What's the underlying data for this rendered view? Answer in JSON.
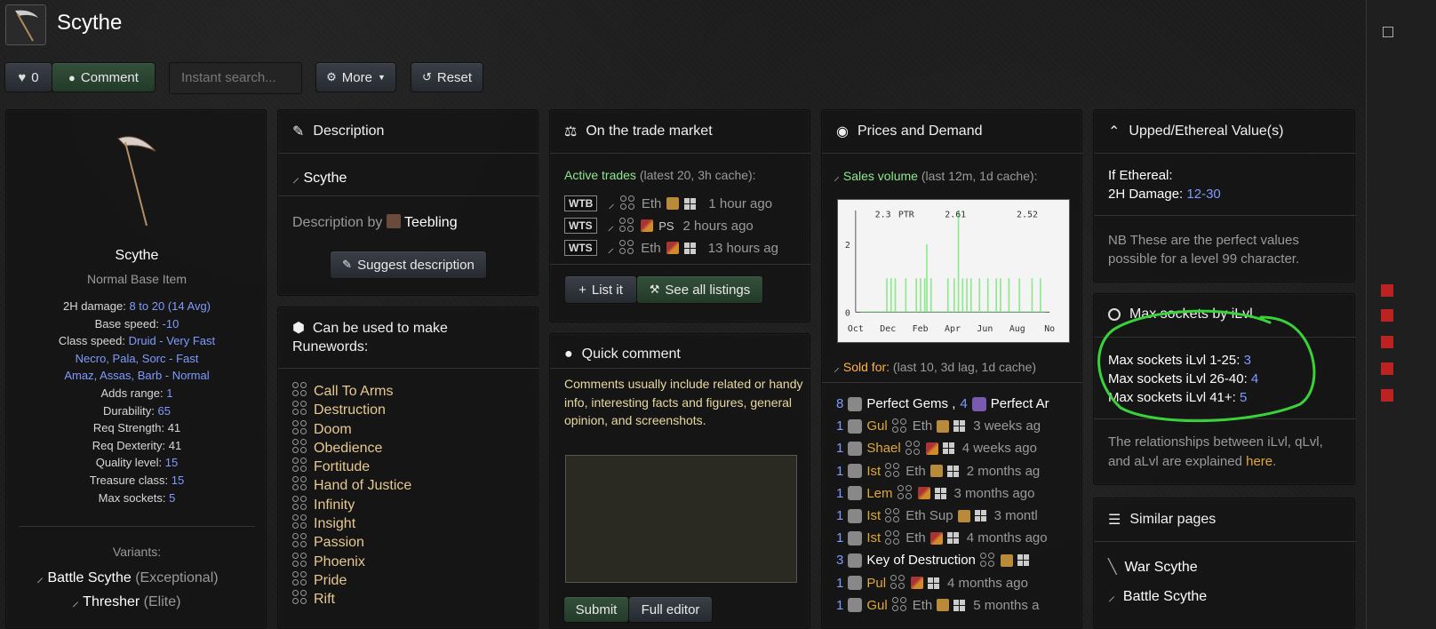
{
  "header": {
    "title": "Scythe"
  },
  "toolbar": {
    "like_count": "0",
    "comment_label": "Comment",
    "search_placeholder": "Instant search...",
    "more_label": "More",
    "reset_label": "Reset"
  },
  "item": {
    "name": "Scythe",
    "subtitle": "Normal Base Item",
    "stats": [
      {
        "label": "2H damage:",
        "value": "8 to 20 (14 Avg)"
      },
      {
        "label": "Base speed:",
        "value": "-10"
      },
      {
        "label": "Class speed:",
        "value": "Druid - Very Fast"
      }
    ],
    "class_speed_more": [
      "Necro, Pala, Sorc - Fast",
      "Amaz, Assas, Barb - Normal"
    ],
    "stats2": [
      {
        "label": "Adds range:",
        "value": "1"
      },
      {
        "label": "Durability:",
        "value": "65"
      },
      {
        "label": "Req Strength:",
        "value": "41"
      },
      {
        "label": "Req Dexterity:",
        "value": "41"
      },
      {
        "label": "Quality level:",
        "value": "15"
      },
      {
        "label": "Treasure class:",
        "value": "15"
      },
      {
        "label": "Max sockets:",
        "value": "5"
      }
    ],
    "variants_heading": "Variants:",
    "variants": [
      {
        "name": "Battle Scythe",
        "tier": "(Exceptional)"
      },
      {
        "name": "Thresher",
        "tier": "(Elite)"
      }
    ]
  },
  "description": {
    "heading": "Description",
    "item_name": "Scythe",
    "by_label": "Description by",
    "author": "Teebling",
    "suggest_label": "Suggest description"
  },
  "runewords": {
    "heading_line1": "Can be used to make",
    "heading_line2": "Runewords:",
    "items": [
      "Call To Arms",
      "Destruction",
      "Doom",
      "Obedience",
      "Fortitude",
      "Hand of Justice",
      "Infinity",
      "Insight",
      "Passion",
      "Phoenix",
      "Pride",
      "Rift"
    ]
  },
  "trade": {
    "heading": "On the trade market",
    "active_label": "Active trades",
    "active_note": "(latest 20, 3h cache):",
    "rows": [
      {
        "tag": "WTB",
        "eth": "Eth",
        "time": "1 hour ago"
      },
      {
        "tag": "WTS",
        "eth": "",
        "time": "2 hours ago"
      },
      {
        "tag": "WTS",
        "eth": "Eth",
        "time": "13 hours ag"
      }
    ],
    "list_label": "List it",
    "see_all_label": "See all listings"
  },
  "quick_comment": {
    "heading": "Quick comment",
    "hint": "Comments usually include related or handy info, interesting facts and figures, general opinion, and screenshots.",
    "submit_label": "Submit",
    "editor_label": "Full editor"
  },
  "prices": {
    "heading": "Prices and Demand",
    "sales_label": "Sales volume",
    "sales_note": "(last 12m, 1d cache):",
    "sold_label": "Sold for:",
    "sold_note": "(last 10, 3d lag, 1d cache)",
    "sold": [
      {
        "qty": "8",
        "item": "Perfect Gems ,",
        "qty2": "4",
        "item2": "Perfect Ar",
        "eth": "",
        "time": ""
      },
      {
        "qty": "1",
        "item": "Gul",
        "eth": "Eth",
        "time": "3 weeks ag"
      },
      {
        "qty": "1",
        "item": "Shael",
        "eth": "",
        "time": "4 weeks ago"
      },
      {
        "qty": "1",
        "item": "Ist",
        "eth": "Eth",
        "time": "2 months ag"
      },
      {
        "qty": "1",
        "item": "Lem",
        "eth": "",
        "time": "3 months ago"
      },
      {
        "qty": "1",
        "item": "Ist",
        "eth": "Eth Sup",
        "time": "3 montl"
      },
      {
        "qty": "1",
        "item": "Ist",
        "eth": "Eth",
        "time": "4 months ago"
      },
      {
        "qty": "3",
        "item": "Key of Destruction",
        "eth": "",
        "time": ""
      },
      {
        "qty": "1",
        "item": "Pul",
        "eth": "",
        "time": "4 months ago"
      },
      {
        "qty": "1",
        "item": "Gul",
        "eth": "Eth",
        "time": "5 months a"
      }
    ]
  },
  "chart_data": {
    "type": "bar",
    "title": "",
    "xlabel": "",
    "ylabel": "",
    "ylim": [
      0,
      3
    ],
    "yticks": [
      "0",
      "2"
    ],
    "x_tick_labels": [
      "Oct",
      "Dec",
      "Feb",
      "Apr",
      "Jun",
      "Aug",
      "No"
    ],
    "annotations": [
      "2.3",
      "PTR",
      "2.61",
      "2.52"
    ],
    "values": [
      0,
      0,
      0,
      0,
      0,
      0,
      0,
      0,
      0,
      0,
      0,
      0,
      1,
      0,
      1,
      0,
      1,
      0,
      0,
      0,
      0,
      1,
      0,
      0,
      0,
      0,
      1,
      0,
      1,
      0,
      1,
      2,
      0,
      1,
      0,
      0,
      0,
      0,
      0,
      0,
      0,
      1,
      0,
      0,
      1,
      0,
      3,
      0,
      1,
      0,
      1,
      0,
      1,
      0,
      0,
      0,
      1,
      0,
      0,
      0,
      1,
      0,
      0,
      0,
      1,
      0,
      1,
      0,
      0,
      0,
      1,
      0,
      0,
      0,
      0,
      1,
      0,
      0,
      0,
      0,
      0,
      1,
      0,
      0,
      0,
      1,
      0,
      0
    ]
  },
  "upped": {
    "heading": "Upped/Ethereal Value(s)",
    "if_eth": "If Ethereal:",
    "damage_label": "2H Damage:",
    "damage_value": "12-30",
    "note": "NB These are the perfect values possible for a level 99 character."
  },
  "sockets": {
    "heading": "Max sockets by iLvl",
    "rows": [
      {
        "label": "Max sockets iLvl 1-25:",
        "value": "3"
      },
      {
        "label": "Max sockets iLvl 26-40:",
        "value": "4"
      },
      {
        "label": "Max sockets iLvl 41+:",
        "value": "5"
      }
    ],
    "note_text": "The relationships between iLvl, qLvl, and aLvl are explained",
    "note_link": "here",
    "note_end": "."
  },
  "similar": {
    "heading": "Similar pages",
    "items": [
      "War Scythe",
      "Battle Scythe"
    ]
  },
  "colors": {
    "accent_green": "#3ad23a",
    "link_blue": "#7f9bff",
    "rune_gold": "#e0a83a"
  }
}
